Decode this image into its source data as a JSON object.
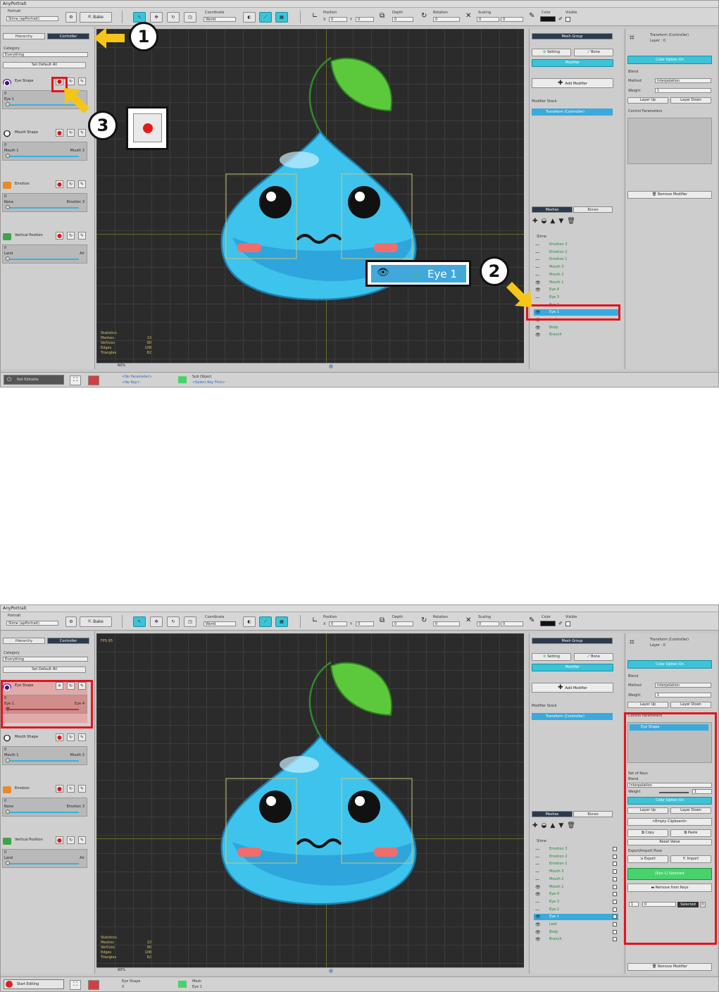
{
  "app_title": "AnyPortrait",
  "toolbar": {
    "portrait_label": "Portrait",
    "portrait_value": "Slime (apPortrait)",
    "bake_label": "Bake",
    "coordinate_label": "Coordinate",
    "coordinate_value": "World",
    "position_label": "Position",
    "x_label": "X",
    "y_label": "Y",
    "x_value": "0",
    "y_value": "0",
    "depth_label": "Depth",
    "depth_value": "0",
    "rotation_label": "Rotation",
    "rotation_value": "0",
    "scaling_label": "Scaling",
    "scale_x": "0",
    "scale_y": "0",
    "color_label": "Color",
    "visible_label": "Visible"
  },
  "left": {
    "tab_hierarchy": "Hierarchy",
    "tab_controller": "Controller",
    "category_label": "Category",
    "category_value": "Everything",
    "set_default_all": "Set Default All",
    "params": [
      {
        "name": "Eye Shape",
        "value": "0",
        "low": "Eye 1",
        "high": "Eye 4"
      },
      {
        "name": "Mouth Shape",
        "value": "0",
        "low": "Mouth 1",
        "high": "Mouth 3"
      },
      {
        "name": "Emotion",
        "value": "0",
        "low": "None",
        "high": "Emotion 3"
      },
      {
        "name": "Vertical Position",
        "value": "0",
        "low": "Land",
        "high": "Air"
      }
    ]
  },
  "viewport": {
    "stats_title": "Statistics",
    "stats": [
      {
        "label": "Meshes",
        "value": "13"
      },
      {
        "label": "Vertices",
        "value": "90"
      },
      {
        "label": "Edges",
        "value": "108"
      },
      {
        "label": "Triangles",
        "value": "62"
      }
    ],
    "zoom": "60%",
    "fps": "FPS 95"
  },
  "mid": {
    "mesh_group": "Mesh Group",
    "setting": "Setting",
    "bone": "Bone",
    "modifier": "Modifier",
    "add_modifier": "Add Modifier",
    "modifier_stack": "Modifier Stack",
    "stack_item": "Transform (Controller)",
    "tab_meshes": "Meshes",
    "tab_bones": "Bones",
    "root": "Slime",
    "meshes": [
      "Emotion 3",
      "Emotion 2",
      "Emotion 1",
      "Mouth 3",
      "Mouth 2",
      "Mouth 1",
      "Eye 4",
      "Eye 3",
      "Eye 2",
      "Eye 1",
      "Leaf",
      "Body",
      "Branch"
    ],
    "selected_mesh": "Eye 1"
  },
  "right": {
    "title": "Transform (Controller)",
    "layer": "Layer : 0",
    "color_option": "Color Option On",
    "blend_label": "Blend",
    "method_label": "Method",
    "method_value": "Interpolation",
    "weight_label": "Weight",
    "weight_value": "1",
    "layer_up": "Layer Up",
    "layer_down": "Layer Down",
    "control_params": "Control Parameters",
    "remove_modifier": "Remove Modifier",
    "selected_param": "Eye Shape",
    "set_of_keys": "Set of Keys",
    "blend_value": "Interpolation",
    "empty_clipboard": "<Empty Clipboard>",
    "copy": "Copy",
    "paste": "Paste",
    "reset_value": "Reset Value",
    "export_import": "Export/Import Pose",
    "export": "Export",
    "import": "Import",
    "selected_key": "[Eye 1] Selected",
    "remove_from_keys": "Remove from Keys",
    "key_index": "1",
    "key_value": "0",
    "selected_badge": "Selected"
  },
  "status1": {
    "mode": "Not Editable",
    "param_line1": "<No Parameter>",
    "param_line2": "<No Key>",
    "sub_object": "Sub Object",
    "sub_hint": "<Select Key First>"
  },
  "status2": {
    "mode": "Start Editing",
    "param_line1": "Eye Shape",
    "param_line2": "0",
    "sub_object": "Mesh",
    "sub_hint": "Eye 1"
  },
  "callouts": [
    "1",
    "2",
    "3"
  ],
  "zoom_label": "Eye 1",
  "colors": {
    "accent": "#3cc3d8",
    "record": "#d21b1b",
    "highlight": "#e8121c",
    "arrow": "#f5c518",
    "grid": "#2b2b2b"
  }
}
